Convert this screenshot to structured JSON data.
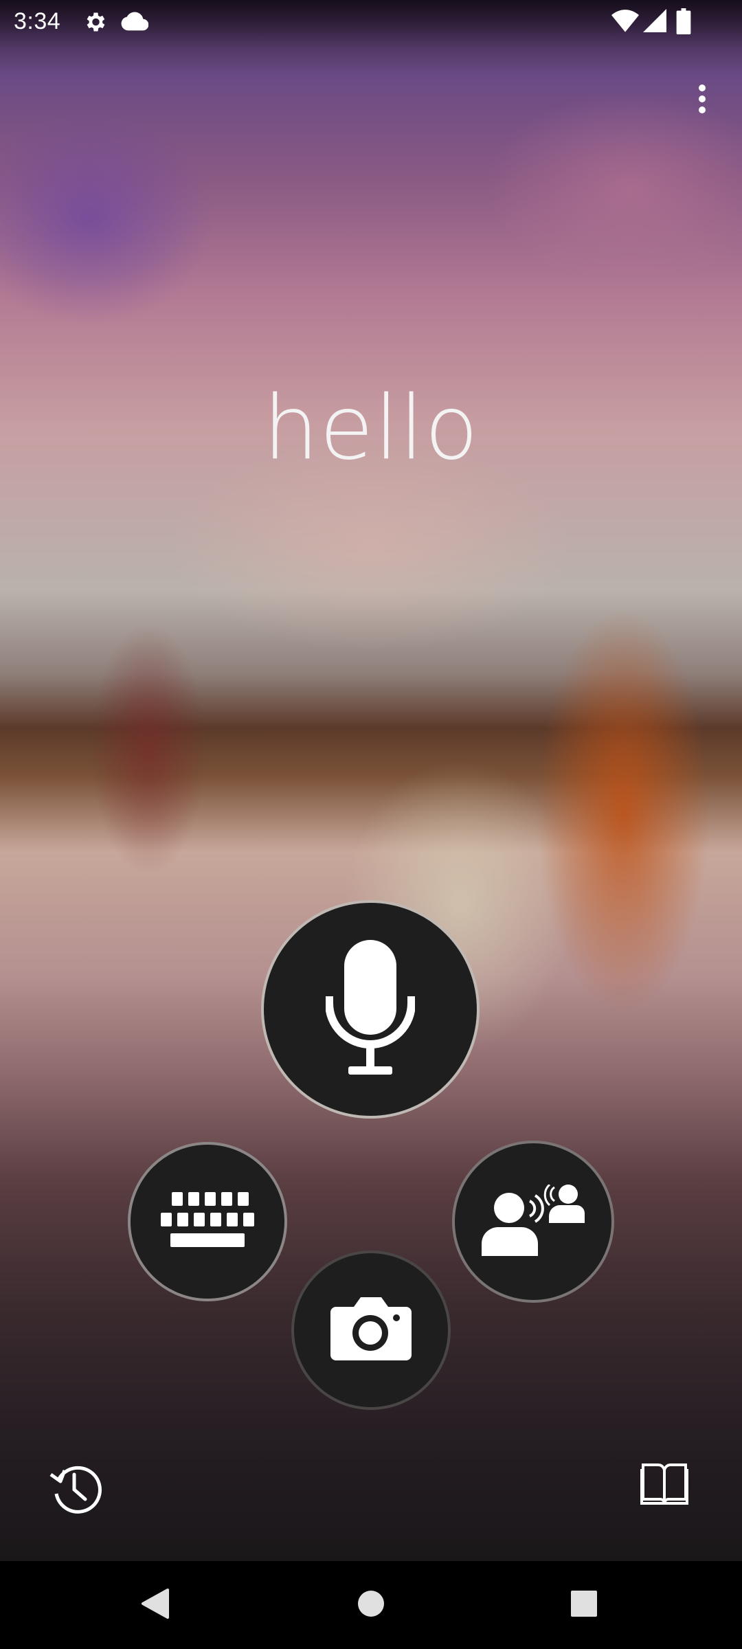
{
  "status_bar": {
    "time": "3:34",
    "icons": [
      "gear-icon",
      "cloud-icon",
      "wifi-icon",
      "signal-icon",
      "battery-icon"
    ]
  },
  "header": {
    "menu_icon": "more-vert-icon"
  },
  "main": {
    "greeting": "hello"
  },
  "actions": {
    "microphone": {
      "icon": "microphone-icon"
    },
    "keyboard": {
      "icon": "keyboard-icon"
    },
    "conversation": {
      "icon": "conversation-icon"
    },
    "camera": {
      "icon": "camera-icon"
    }
  },
  "footer": {
    "history_icon": "history-icon",
    "phrasebook_icon": "phrasebook-icon"
  },
  "system_nav": {
    "icons": [
      "back-icon",
      "home-icon",
      "recents-icon"
    ]
  },
  "colors": {
    "button_fill": "#1e1e1e",
    "icon": "#ffffff",
    "nav_bar": "#000000"
  }
}
